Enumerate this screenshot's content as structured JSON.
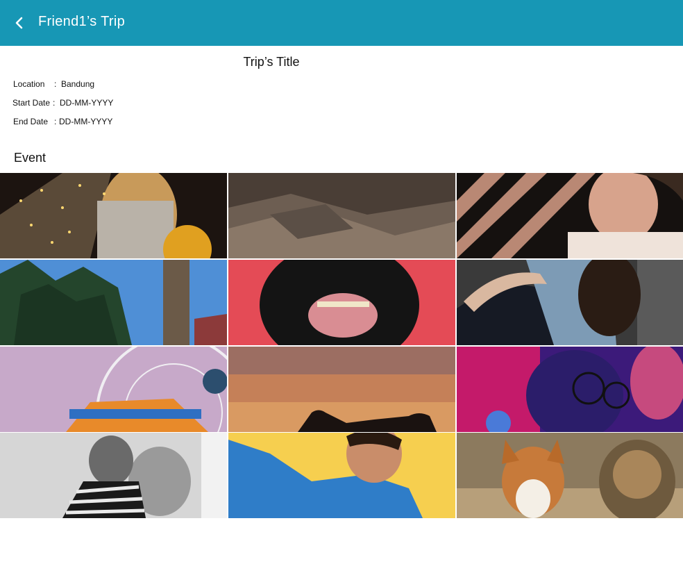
{
  "appbar": {
    "title": "Friend1’s Trip",
    "back_icon": "chevron-left-icon",
    "color": "#1797b5"
  },
  "trip": {
    "title": "Trip’s Title",
    "location_label": "Location",
    "location_value": "Bandung",
    "start_label": "Start Date",
    "start_value": "DD-MM-YYYY",
    "end_label": "End Date",
    "end_value": "DD-MM-YYYY",
    "separator": ":"
  },
  "event": {
    "heading": "Event",
    "photos": [
      {
        "subject": "woman with glowing umbrella lights"
      },
      {
        "subject": "rocky mountain slope"
      },
      {
        "subject": "woman smiling by striped wall"
      },
      {
        "subject": "tall trees and blue sky"
      },
      {
        "subject": "black dog open mouth on red"
      },
      {
        "subject": "couple embracing in denim jacket"
      },
      {
        "subject": "ferris wheel against lilac sky"
      },
      {
        "subject": "silhouettes at sunset"
      },
      {
        "subject": "person with glasses in neon light"
      },
      {
        "subject": "man in striped shirt black and white"
      },
      {
        "subject": "smiling woman in denim on yellow"
      },
      {
        "subject": "corgi and terrier dogs"
      }
    ]
  }
}
